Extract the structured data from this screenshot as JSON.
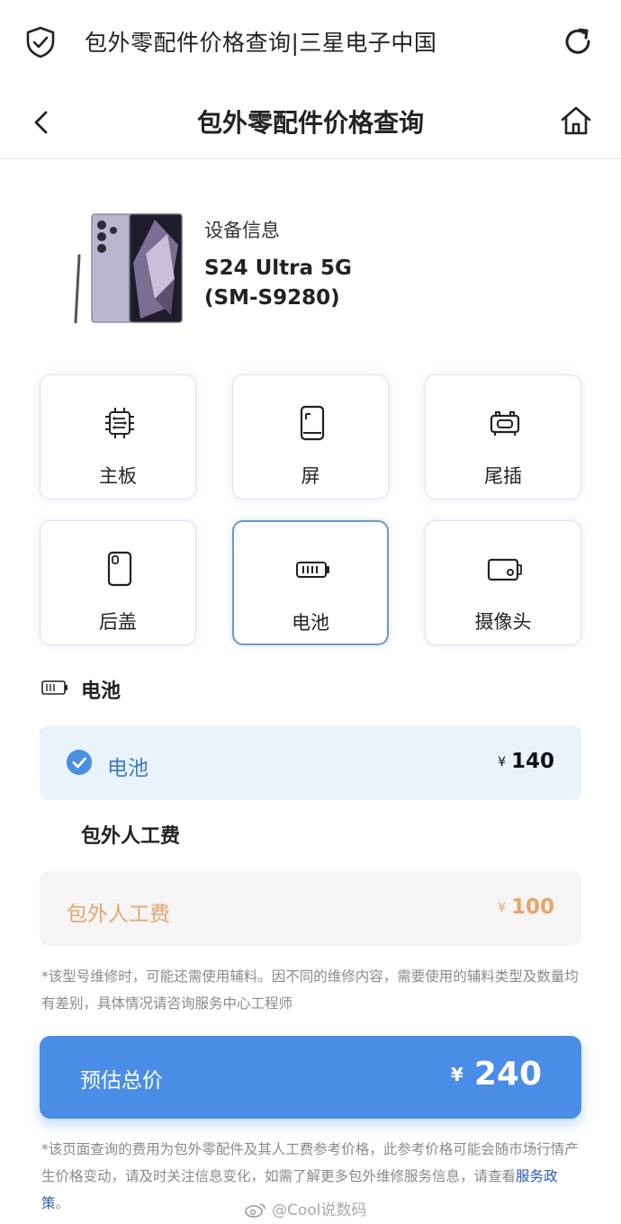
{
  "browser": {
    "title": "包外零配件价格查询|三星电子中国",
    "icons": {
      "security": "shield-check-icon",
      "reload": "reload-icon"
    }
  },
  "header": {
    "title": "包外零配件价格查询",
    "icons": {
      "back": "chevron-left-icon",
      "home": "home-icon"
    }
  },
  "device": {
    "label": "设备信息",
    "model_line1": "S24 Ultra 5G",
    "model_line2": "(SM-S9280)"
  },
  "parts": [
    {
      "label": "主板",
      "icon": "chip-icon",
      "selected": false
    },
    {
      "label": "屏",
      "icon": "screen-icon",
      "selected": false
    },
    {
      "label": "尾插",
      "icon": "charging-port-icon",
      "selected": false
    },
    {
      "label": "后盖",
      "icon": "back-cover-icon",
      "selected": false
    },
    {
      "label": "电池",
      "icon": "battery-icon",
      "selected": true
    },
    {
      "label": "摄像头",
      "icon": "camera-icon",
      "selected": false
    }
  ],
  "section": {
    "title": "电池"
  },
  "battery_row": {
    "label": "电池",
    "currency": "¥",
    "price": "140"
  },
  "labor_section": {
    "title": "包外人工费"
  },
  "labor_row": {
    "label": "包外人工费",
    "currency": "¥",
    "price": "100"
  },
  "note1": "*该型号维修时，可能还需使用辅料。因不同的维修内容，需要使用的辅料类型及数量均有差别，具体情况请咨询服务中心工程师",
  "total": {
    "label": "预估总价",
    "currency": "¥",
    "value": "240"
  },
  "note2": {
    "text": "*该页面查询的费用为包外零配件及其人工费参考价格，此参考价格可能会随市场行情产生价格变动，请及时关注信息变化，如需了解更多包外维修服务信息，请查看",
    "link": "服务政策",
    "end": "。"
  },
  "watermark": "@Cool说数码",
  "colors": {
    "accent": "#4a8de6",
    "labor": "#e8a46a",
    "battery_bg": "#e9f3fc"
  }
}
